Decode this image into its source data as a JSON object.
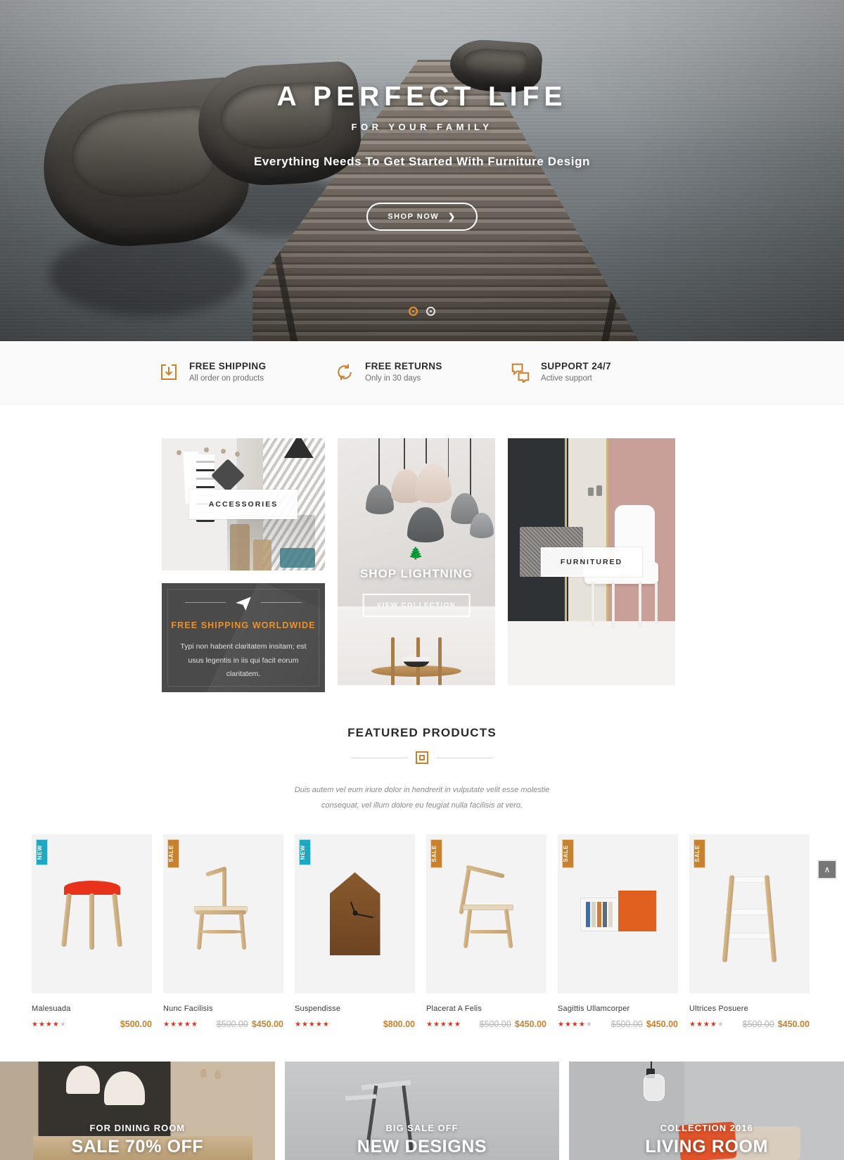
{
  "hero": {
    "title": "A PERFECT LIFE",
    "subtitle": "FOR YOUR FAMILY",
    "description": "Everything Needs To Get Started With Furniture Design",
    "cta_label": "SHOP NOW",
    "cta_arrow": "❯",
    "slide_count": 2,
    "active_slide": 1
  },
  "services": [
    {
      "icon": "download-box-icon",
      "title": "FREE SHIPPING",
      "subtitle": "All order on products"
    },
    {
      "icon": "refresh-cycle-icon",
      "title": "FREE RETURNS",
      "subtitle": "Only in 30 days"
    },
    {
      "icon": "chat-bubbles-icon",
      "title": "SUPPORT 24/7",
      "subtitle": "Active support"
    }
  ],
  "categories": {
    "accessories_label": "ACCESSORIES",
    "lightning_title": "SHOP LIGHTNING",
    "lightning_cta": "VIEW COLLECTION",
    "furnitured_label": "FURNITURED",
    "shipping": {
      "icon": "paper-plane-icon",
      "title": "FREE SHIPPING WORLDWIDE",
      "text": "Typi non habent claritatem insitam; est usus legentis in iis qui facit eorum claritatem."
    }
  },
  "featured": {
    "title": "FEATURED PRODUCTS",
    "description": "Duis autem vel eum iriure dolor in hendrerit in vulputate velit esse molestie consequat, vel illum dolore eu feugiat nulla facilisis at vero."
  },
  "products": [
    {
      "name": "Malesuada",
      "badge": "NEW",
      "badge_type": "new",
      "rating": 4,
      "stars": "★★★★",
      "stars_off": "★",
      "old_price": "",
      "price": "$500.00"
    },
    {
      "name": "Nunc Facilisis",
      "badge": "SALE",
      "badge_type": "sale",
      "rating": 4.5,
      "stars": "★★★★★",
      "stars_off": "",
      "old_price": "$500.00",
      "price": "$450.00"
    },
    {
      "name": "Suspendisse",
      "badge": "NEW",
      "badge_type": "new",
      "rating": 5,
      "stars": "★★★★★",
      "stars_off": "",
      "old_price": "",
      "price": "$800.00"
    },
    {
      "name": "Placerat A Felis",
      "badge": "SALE",
      "badge_type": "sale",
      "rating": 5,
      "stars": "★★★★★",
      "stars_off": "",
      "old_price": "$500.00",
      "price": "$450.00"
    },
    {
      "name": "Sagittis Ullamcorper",
      "badge": "SALE",
      "badge_type": "sale",
      "rating": 4,
      "stars": "★★★★",
      "stars_off": "★",
      "old_price": "$500.00",
      "price": "$450.00"
    },
    {
      "name": "Ultrices Posuere",
      "badge": "SALE",
      "badge_type": "sale",
      "rating": 3.5,
      "stars": "★★★★",
      "stars_off": "★",
      "old_price": "$500.00",
      "price": "$450.00"
    }
  ],
  "promos": [
    {
      "subtitle": "FOR DINING ROOM",
      "title": "SALE 70% OFF"
    },
    {
      "subtitle": "BIG SALE OFF",
      "title": "NEW DESIGNS"
    },
    {
      "subtitle": "COLLECTION 2016",
      "title": "LIVING ROOM"
    }
  ],
  "scroll_top": {
    "icon": "chevron-up-icon",
    "glyph": "∧"
  },
  "colors": {
    "accent_orange": "#C8822E",
    "heading_orange": "#E8922E",
    "badge_new": "#1FA8BE",
    "badge_sale": "#C8822E",
    "star_red": "#E0321F",
    "dark_panel": "#4A4A4A"
  }
}
